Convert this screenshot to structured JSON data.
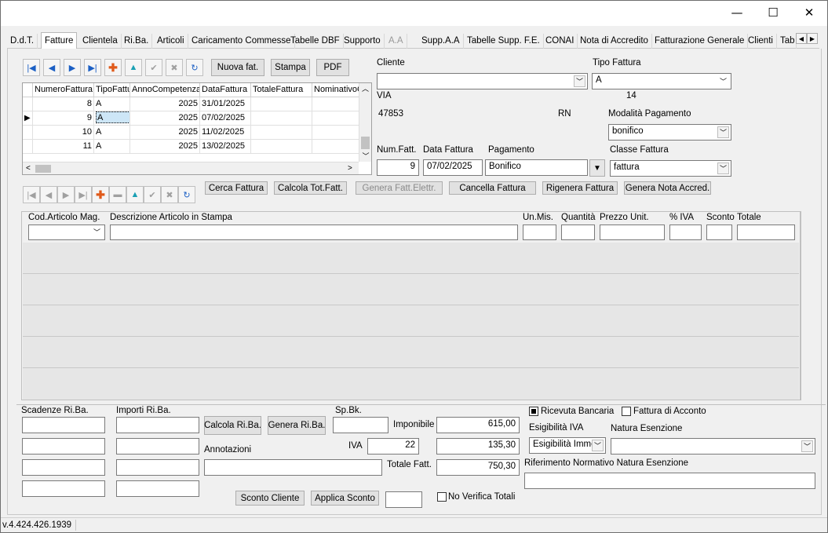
{
  "window": {
    "minimize": "—",
    "maximize": "☐",
    "close": "✕"
  },
  "tabs": [
    "D.d.T.",
    "Fatture",
    "Clientela",
    "Ri.Ba.",
    "Articoli",
    "Caricamento Commesse",
    "Tabelle DBF",
    "Supporto",
    "A.A",
    "Supp.A.A",
    "Tabelle Supp. F.E.",
    "CONAI",
    "Nota di Accredito",
    "Fatturazione Generale",
    "Clienti",
    "Tab"
  ],
  "active_tab": "Fatture",
  "toolbar": {
    "nuova": "Nuova fat.",
    "stampa": "Stampa",
    "pdf": "PDF"
  },
  "grid": {
    "columns": [
      "NumeroFattura",
      "TipoFattu",
      "AnnoCompetenza",
      "DataFattura",
      "TotaleFattura",
      "NominativoC"
    ],
    "rows": [
      {
        "num": "8",
        "tipo": "A",
        "anno": "2025",
        "data": "31/01/2025"
      },
      {
        "num": "9",
        "tipo": "A",
        "anno": "2025",
        "data": "07/02/2025"
      },
      {
        "num": "10",
        "tipo": "A",
        "anno": "2025",
        "data": "11/02/2025"
      },
      {
        "num": "11",
        "tipo": "A",
        "anno": "2025",
        "data": "13/02/2025"
      }
    ]
  },
  "actions": {
    "cerca": "Cerca Fattura",
    "calcola": "Calcola Tot.Fatt.",
    "genera_elettr": "Genera Fatt.Elettr.",
    "cancella": "Cancella Fattura",
    "rigenera": "Rigenera Fattura",
    "nota": "Genera Nota Accred."
  },
  "header": {
    "cliente_label": "Cliente",
    "cliente_value": "",
    "via": "VIA",
    "cap": "47853",
    "prov": "RN",
    "tipo_fattura_label": "Tipo Fattura",
    "tipo_fattura": "A",
    "tipo_code": "14",
    "modalita_label": "Modalità Pagamento",
    "modalita": "bonifico",
    "num_label": "Num.Fatt.",
    "num": "9",
    "data_label": "Data Fattura",
    "data": "07/02/2025",
    "pagamento_label": "Pagamento",
    "pagamento": "Bonifico",
    "classe_label": "Classe Fattura",
    "classe": "fattura"
  },
  "detail": {
    "cod": "Cod.Articolo Mag.",
    "desc": "Descrizione Articolo in Stampa",
    "um": "Un.Mis.",
    "qta": "Quantità",
    "prezzo": "Prezzo Unit.",
    "iva": "% IVA",
    "sconto": "Sconto",
    "totale": "Totale"
  },
  "footer": {
    "scadenze": "Scadenze Ri.Ba.",
    "importi": "Importi Ri.Ba.",
    "calcola_riba": "Calcola Ri.Ba.",
    "genera_riba": "Genera Ri.Ba.",
    "spbk": "Sp.Bk.",
    "imponibile_label": "Imponibile",
    "imponibile": "615,00",
    "iva_label": "IVA",
    "iva_perc": "22",
    "iva_value": "135,30",
    "annotazioni": "Annotazioni",
    "totale_label": "Totale Fatt.",
    "totale": "750,30",
    "ricevuta": "Ricevuta Bancaria",
    "acconto": "Fattura di Acconto",
    "esigibilita_label": "Esigibilità IVA",
    "esigibilita": "Esigibilità Immed",
    "natura_label": "Natura Esenzione",
    "rif_label": "Riferimento Normativo Natura Esenzione",
    "sconto_cliente": "Sconto Cliente",
    "applica_sconto": "Applica Sconto",
    "no_verifica": "No Verifica Totali"
  },
  "status": {
    "version": "v.4.424.426.1939"
  }
}
